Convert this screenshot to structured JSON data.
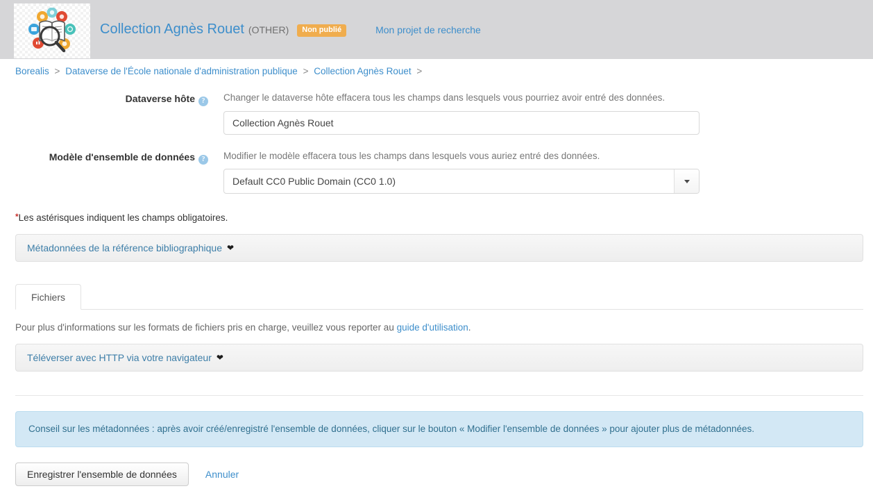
{
  "header": {
    "logo_alt": "dataverse-collection-logo",
    "collection_title": "Collection Agnès Rouet",
    "collection_type": "(OTHER)",
    "badge_unpublished": "Non publié",
    "project_link": "Mon projet de recherche",
    "colors": {
      "band_background": "#d6d6d8",
      "link_blue": "#3d8ecb",
      "badge_orange": "#f0ad4e"
    }
  },
  "breadcrumb": {
    "separator": ">",
    "items": [
      {
        "label": "Borealis"
      },
      {
        "label": "Dataverse de l'École nationale d'administration publique"
      },
      {
        "label": "Collection Agnès Rouet"
      }
    ],
    "trailing_separator": ">"
  },
  "form": {
    "host_dataverse": {
      "label": "Dataverse hôte",
      "help_icon": "question-circle-icon",
      "help_glyph": "?",
      "note": "Changer le dataverse hôte effacera tous les champs dans lesquels vous pourriez avoir entré des données.",
      "value": "Collection Agnès Rouet",
      "placeholder": "Collection Agnès Rouet"
    },
    "dataset_template": {
      "label": "Modèle d'ensemble de données",
      "help_icon": "question-circle-icon",
      "help_glyph": "?",
      "note": "Modifier le modèle effacera tous les champs dans lesquels vous auriez entré des données.",
      "selected": "Default CC0 Public Domain (CC0 1.0)",
      "caret_icon": "caret-down-icon"
    },
    "required_note": {
      "star": "*",
      "text": "Les astérisques indiquent les champs obligatoires."
    }
  },
  "accordions": [
    {
      "label": "Métadonnées de la référence bibliographique",
      "chevron_icon": "chevron-down-icon",
      "chevron_glyph": "❤"
    }
  ],
  "files_section": {
    "tab_label": "Fichiers",
    "note_prefix": "Pour plus d'informations sur les formats de fichiers pris en charge, veuillez vous reporter au ",
    "note_link": "guide d'utilisation",
    "note_suffix": ".",
    "upload_accordion": {
      "label": "Téléverser avec HTTP via votre navigateur",
      "chevron_icon": "chevron-down-icon",
      "chevron_glyph": "❤"
    }
  },
  "alert": {
    "icon": "info-icon",
    "text": "Conseil sur les métadonnées : après avoir créé/enregistré l'ensemble de données, cliquer sur le bouton « Modifier l'ensemble de données » pour ajouter plus de métadonnées.",
    "color": "#31708f",
    "background": "#d3e8f5"
  },
  "footer": {
    "save_label": "Enregistrer l'ensemble de données",
    "cancel_label": "Annuler"
  }
}
